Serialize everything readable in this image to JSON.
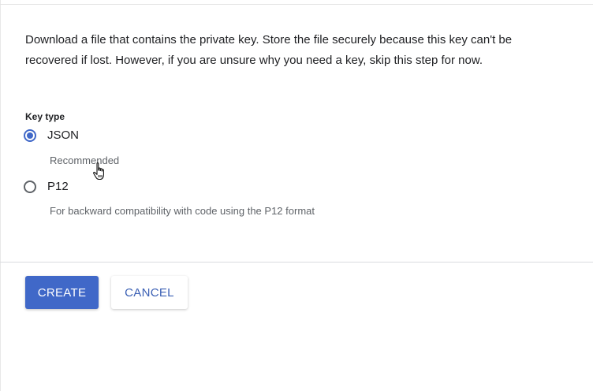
{
  "description": "Download a file that contains the private key. Store the file securely because this key can't be recovered if lost. However, if you are unsure why you need a key, skip this step for now.",
  "key_type": {
    "label": "Key type",
    "options": [
      {
        "label": "JSON",
        "helper": "Recommended",
        "selected": true
      },
      {
        "label": "P12",
        "helper": "For backward compatibility with code using the P12 format",
        "selected": false
      }
    ]
  },
  "actions": {
    "create_label": "CREATE",
    "cancel_label": "CANCEL"
  },
  "colors": {
    "accent": "#4068c8",
    "cancel_text": "#3a5fb4",
    "divider": "#dadce0"
  },
  "icons": {
    "cursor": "hand-pointer-icon"
  }
}
